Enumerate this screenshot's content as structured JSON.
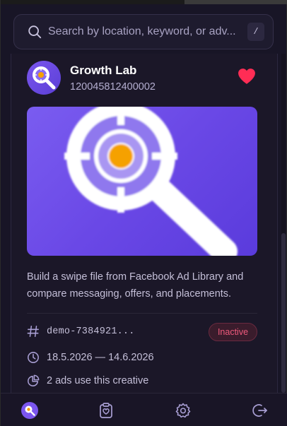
{
  "search": {
    "placeholder": "Search by location, keyword, or adv...",
    "shortcut": "/"
  },
  "card": {
    "title": "Growth Lab",
    "page_id": "120045812400002",
    "favorited": true,
    "description": "Build a swipe file from Facebook Ad Library and compare messaging, offers, and placements.",
    "ad_id": "demo-7384921...",
    "status": "Inactive",
    "date_range": "18.5.2026 — 14.6.2026",
    "usage": "2 ads use this creative"
  },
  "icons": {
    "search": "search-icon",
    "heart": "heart-icon",
    "hash": "hash-icon",
    "clock": "clock-icon",
    "pie": "pie-chart-icon",
    "nav": [
      "search-icon",
      "clipboard-heart-icon",
      "gear-icon",
      "logout-icon"
    ]
  },
  "colors": {
    "accent": "#7b56ee",
    "heart": "#ff2d55",
    "status_inactive": "#ef5a7c",
    "brand_orange": "#f5a100"
  }
}
